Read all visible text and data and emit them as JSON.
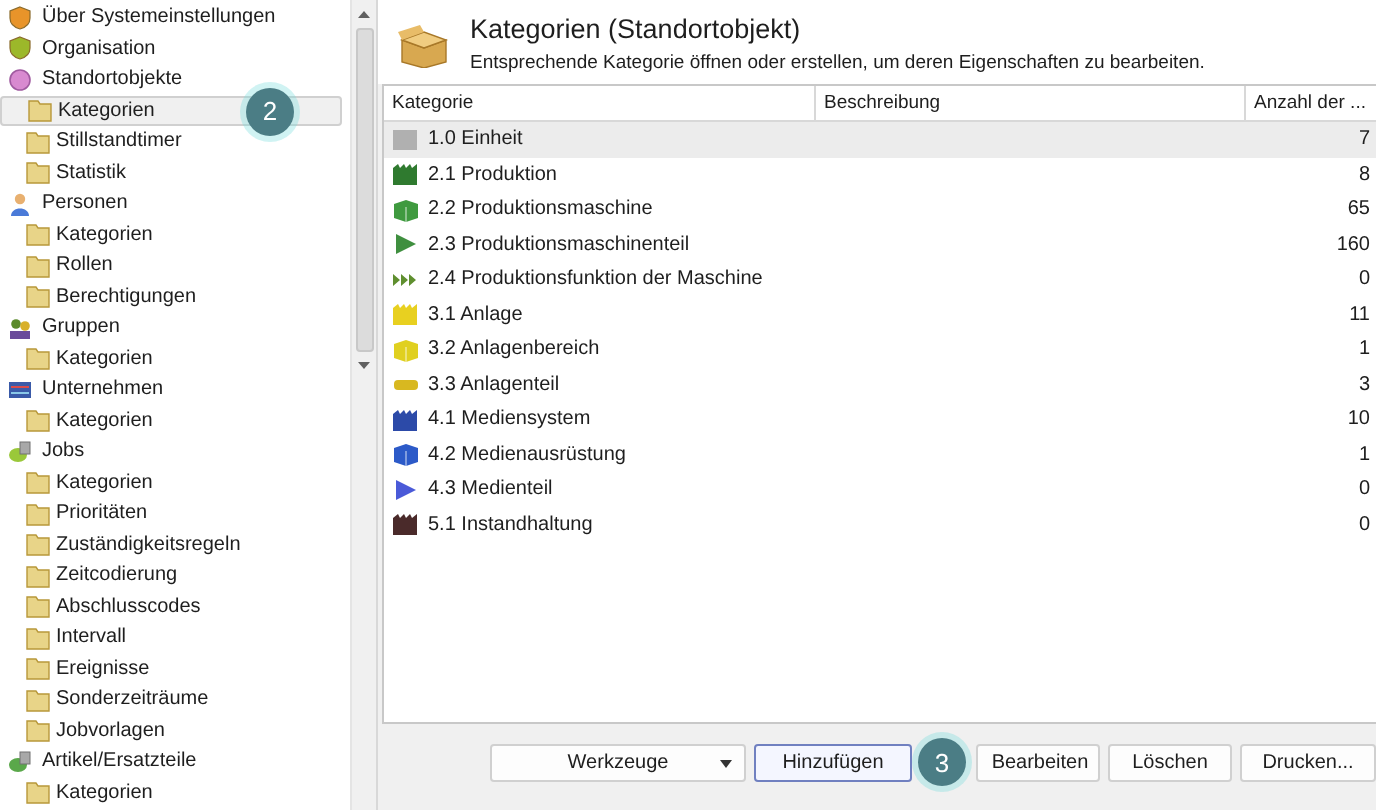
{
  "sidebar": {
    "items": [
      {
        "label": "Über Systemeinstellungen",
        "kind": "settings"
      },
      {
        "label": "Organisation",
        "kind": "organisation"
      },
      {
        "label": "Standortobjekte",
        "kind": "location",
        "children": [
          {
            "label": "Kategorien",
            "selected": true,
            "callout": "2"
          },
          {
            "label": "Stillstandtimer",
            "selected": false
          },
          {
            "label": "Statistik",
            "selected": false
          }
        ]
      },
      {
        "label": "Personen",
        "kind": "person",
        "children": [
          {
            "label": "Kategorien",
            "selected": false
          },
          {
            "label": "Rollen",
            "selected": false
          },
          {
            "label": "Berechtigungen",
            "selected": false
          }
        ]
      },
      {
        "label": "Gruppen",
        "kind": "group",
        "children": [
          {
            "label": "Kategorien",
            "selected": false
          }
        ]
      },
      {
        "label": "Unternehmen",
        "kind": "company",
        "children": [
          {
            "label": "Kategorien",
            "selected": false
          }
        ]
      },
      {
        "label": "Jobs",
        "kind": "jobs",
        "children": [
          {
            "label": "Kategorien",
            "selected": false
          },
          {
            "label": "Prioritäten",
            "selected": false
          },
          {
            "label": "Zuständigkeitsregeln",
            "selected": false
          },
          {
            "label": "Zeitcodierung",
            "selected": false
          },
          {
            "label": "Abschlusscodes",
            "selected": false
          },
          {
            "label": "Intervall",
            "selected": false
          },
          {
            "label": "Ereignisse",
            "selected": false
          },
          {
            "label": "Sonderzeiträume",
            "selected": false
          },
          {
            "label": "Jobvorlagen",
            "selected": false
          }
        ]
      },
      {
        "label": "Artikel/Ersatzteile",
        "kind": "parts",
        "children": [
          {
            "label": "Kategorien",
            "selected": false
          }
        ]
      }
    ]
  },
  "header": {
    "title": "Kategorien (Standortobjekt)",
    "subtitle": "Entsprechende Kategorie öffnen oder erstellen, um deren Eigenschaften zu bearbeiten."
  },
  "table": {
    "columns": [
      "Kategorie",
      "Beschreibung",
      "Anzahl der ..."
    ],
    "rows": [
      {
        "name": "1.0 Einheit",
        "count": "7",
        "kind": "plain",
        "color": "#b0b0b0",
        "selected": true
      },
      {
        "name": "2.1 Produktion",
        "count": "8",
        "kind": "factory",
        "color": "#2f7a2f",
        "selected": false
      },
      {
        "name": "2.2 Produktionsmaschine",
        "count": "65",
        "kind": "cube",
        "color": "#3f9a3f",
        "selected": false
      },
      {
        "name": "2.3 Produktionsmaschinenteil",
        "count": "160",
        "kind": "play",
        "color": "#3f8f3f",
        "selected": false
      },
      {
        "name": "2.4 Produktionsfunktion der Maschine",
        "count": "0",
        "kind": "forward",
        "color": "#5f8f2f",
        "selected": false
      },
      {
        "name": "3.1 Anlage",
        "count": "11",
        "kind": "factory",
        "color": "#e8d020",
        "selected": false
      },
      {
        "name": "3.2 Anlagenbereich",
        "count": "1",
        "kind": "cube",
        "color": "#e0d020",
        "selected": false
      },
      {
        "name": "3.3 Anlagenteil",
        "count": "3",
        "kind": "bar",
        "color": "#d8b820",
        "selected": false
      },
      {
        "name": "4.1 Mediensystem",
        "count": "10",
        "kind": "factory",
        "color": "#2c4aa8",
        "selected": false
      },
      {
        "name": "4.2 Medienausrüstung",
        "count": "1",
        "kind": "cube",
        "color": "#2c5ac8",
        "selected": false
      },
      {
        "name": "4.3 Medienteil",
        "count": "0",
        "kind": "play",
        "color": "#4a5ad8",
        "selected": false
      },
      {
        "name": "5.1 Instandhaltung",
        "count": "0",
        "kind": "factory",
        "color": "#4a2a2a",
        "selected": false
      }
    ]
  },
  "buttons": [
    {
      "label": "Werkzeuge",
      "kind": "dropdown",
      "focused": false
    },
    {
      "label": "Hinzufügen",
      "kind": "plain",
      "focused": true,
      "callout": "3"
    },
    {
      "label": "Bearbeiten",
      "kind": "plain",
      "focused": false
    },
    {
      "label": "Löschen",
      "kind": "plain",
      "focused": false
    },
    {
      "label": "Drucken...",
      "kind": "plain",
      "focused": false
    }
  ]
}
